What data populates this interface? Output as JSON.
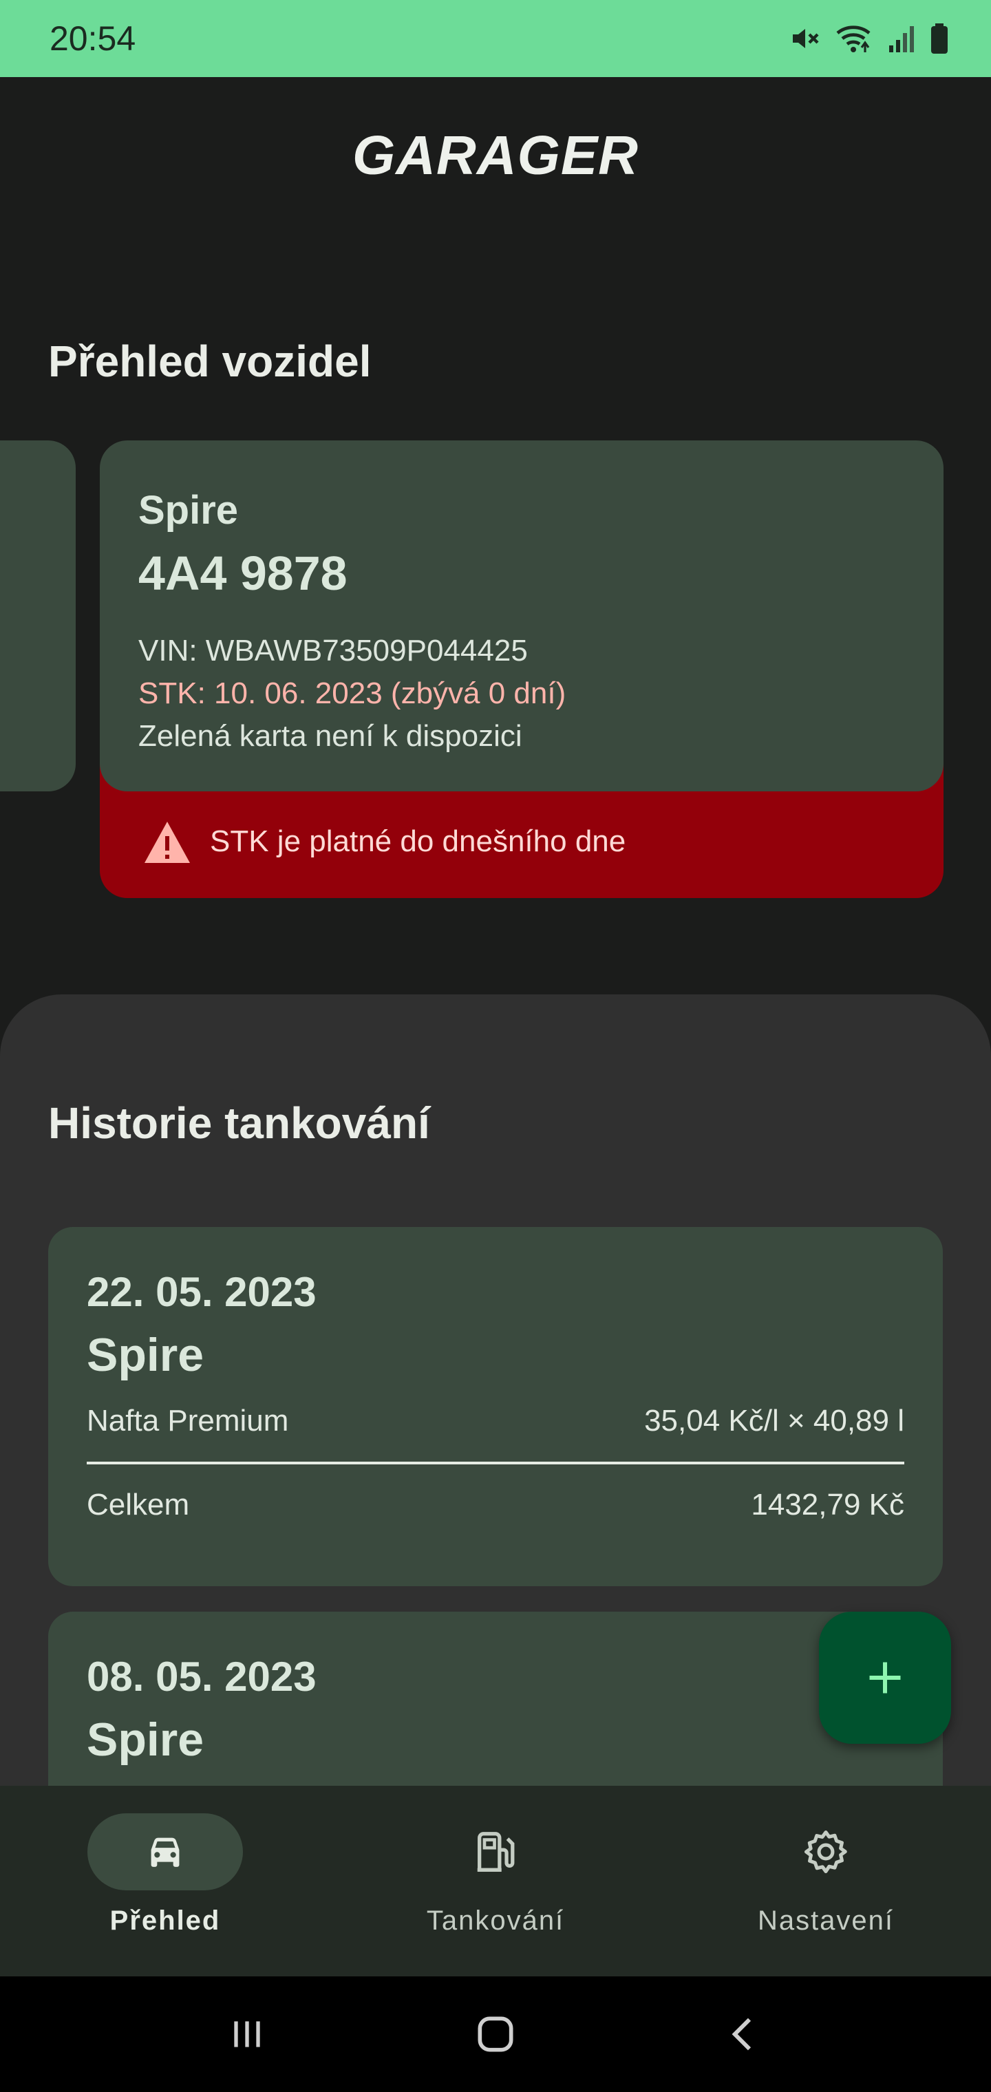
{
  "status_bar": {
    "time": "20:54",
    "icons": [
      "mute-icon",
      "wifi-icon",
      "signal-icon",
      "battery-icon"
    ]
  },
  "app": {
    "title": "GARAGER"
  },
  "vehicles": {
    "section_title": "Přehled vozidel",
    "card": {
      "name": "Spire",
      "plate": "4A4 9878",
      "vin": "VIN: WBAWB73509P044425",
      "stk": "STK: 10. 06. 2023 (zbývá 0 dní)",
      "green_card": "Zelená karta není k dispozici",
      "alert": "STK je platné do dnešního dne"
    }
  },
  "history": {
    "section_title": "Historie tankování",
    "entries": [
      {
        "date": "22. 05. 2023",
        "vehicle": "Spire",
        "fuel": "Nafta Premium",
        "detail": "35,04 Kč/l × 40,89 l",
        "total_label": "Celkem",
        "total_value": "1432,79 Kč"
      },
      {
        "date": "08. 05. 2023",
        "vehicle": "Spire"
      }
    ]
  },
  "fab": {
    "icon": "plus-icon"
  },
  "bottom_nav": {
    "items": [
      {
        "label": "Přehled",
        "icon": "car-icon",
        "active": true
      },
      {
        "label": "Tankování",
        "icon": "fuel-pump-icon",
        "active": false
      },
      {
        "label": "Nastavení",
        "icon": "gear-icon",
        "active": false
      }
    ]
  },
  "colors": {
    "status_bar": "#6ddc98",
    "background": "#1b1c1b",
    "card": "#3a4a3e",
    "alert": "#93000a",
    "alert_text": "#ffdad6",
    "warning_text": "#ffb4ab",
    "fab": "#00522e",
    "fab_icon": "#8ef5b0",
    "nav": "#232a24"
  }
}
